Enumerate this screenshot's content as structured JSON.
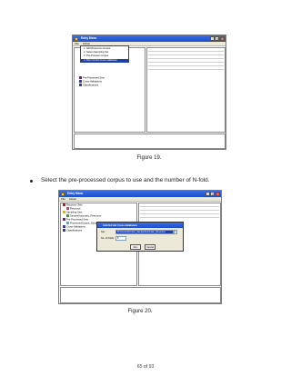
{
  "figure19": {
    "window_title": "Entry Menu",
    "menu_bar": [
      "File",
      "Action"
    ],
    "popup_menu": [
      "1. Add Resource Corpus",
      "2. Select Sampling Set",
      "3. Pre-Process Corpus",
      "4. Run N-Fold Cross-Validation"
    ],
    "tree_items": [
      "Pre-Processed Sets",
      "Cross-Validations",
      "Classifications"
    ],
    "caption": "Figure 19."
  },
  "instruction": "Select the pre-processed corpus to use and the number of N-fold.",
  "figure20": {
    "window_title": "Entry Menu",
    "menu_bar": [
      "File",
      "Action"
    ],
    "tree_items": [
      "Resource Sets",
      "Resource",
      "Sampling Sets",
      "SampleAutomatic_Resource",
      "Pre-Processed Sets",
      "ProcessedCorpus_SampleAutomatic_Resour",
      "Cross-Validations",
      "Classifications"
    ],
    "dialog_title": "Add N-Fold Cross-Validation",
    "dialog_set_label": "Set:",
    "dialog_set_value": "ProcessedCorpus_SampleAutomatic_Resource",
    "dialog_nfold_label": "No. of Folds:",
    "dialog_nfold_value": "5",
    "run_button": "Run",
    "cancel_button": "Cancel",
    "caption": "Figure 20."
  },
  "page_number": "65 of 93"
}
